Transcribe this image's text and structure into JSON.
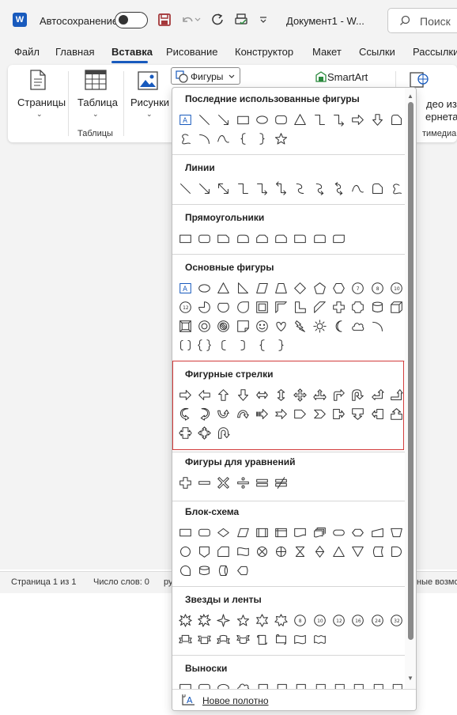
{
  "titlebar": {
    "logo_letter": "W",
    "autosave_label": "Автосохранение",
    "doc_title": "Документ1 - W...",
    "search_label": "Поиск"
  },
  "tabs": [
    {
      "label": "Файл"
    },
    {
      "label": "Главная"
    },
    {
      "label": "Вставка",
      "active": true
    },
    {
      "label": "Рисование"
    },
    {
      "label": "Конструктор"
    },
    {
      "label": "Макет"
    },
    {
      "label": "Ссылки"
    },
    {
      "label": "Рассылки"
    }
  ],
  "ribbon": {
    "pages_label": "Страницы",
    "table_label": "Таблица",
    "tables_group": "Таблицы",
    "pictures_label": "Рисунки",
    "shapes_label": "Фигуры",
    "smartart_label": "SmartArt",
    "video_label_1": "део из",
    "video_label_2": "ернета",
    "media_group": "тимедиа"
  },
  "status": {
    "page": "Страница 1 из 1",
    "words": "Число слов: 0",
    "lang_fragment": "ру",
    "access_fragment": "ные возмо"
  },
  "panel": {
    "sections": [
      {
        "title": "Последние использованные фигуры"
      },
      {
        "title": "Линии"
      },
      {
        "title": "Прямоугольники"
      },
      {
        "title": "Основные фигуры"
      },
      {
        "title": "Фигурные стрелки"
      },
      {
        "title": "Фигуры для уравнений"
      },
      {
        "title": "Блок-схема"
      },
      {
        "title": "Звезды и ленты"
      },
      {
        "title": "Выноски"
      }
    ],
    "footer_label": "Новое полотно"
  },
  "colors": {
    "accent": "#185abd",
    "highlight": "#d23b3b",
    "save_icon": "#a4373a"
  }
}
